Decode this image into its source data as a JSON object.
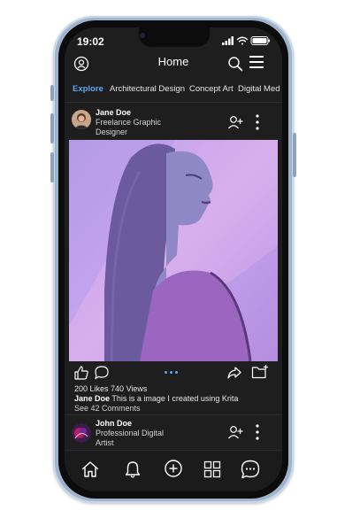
{
  "status_bar": {
    "time": "19:02"
  },
  "header": {
    "title": "Home"
  },
  "tabs": [
    {
      "label": "Explore",
      "active": true
    },
    {
      "label": "Architectural Design",
      "active": false
    },
    {
      "label": "Concept Art",
      "active": false
    },
    {
      "label": "Digital Med",
      "active": false
    }
  ],
  "post": {
    "author": "Jane Doe",
    "role": "Freelance Graphic Designer",
    "likes": "200 Likes",
    "views": "740 Views",
    "caption_author": "Jane Doe",
    "caption_text": "This is a image I created using Krita",
    "comments": "See 42 Comments",
    "carousel_pages": 3,
    "carousel_active": 1
  },
  "next_post": {
    "author": "John Doe",
    "role": "Professional Digital Artist"
  },
  "bottom_nav": [
    "home-icon",
    "bell-icon",
    "add-icon",
    "grid-icon",
    "chat-icon"
  ],
  "colors": {
    "accent": "#5aa9f0",
    "background": "#1e1e1e"
  }
}
